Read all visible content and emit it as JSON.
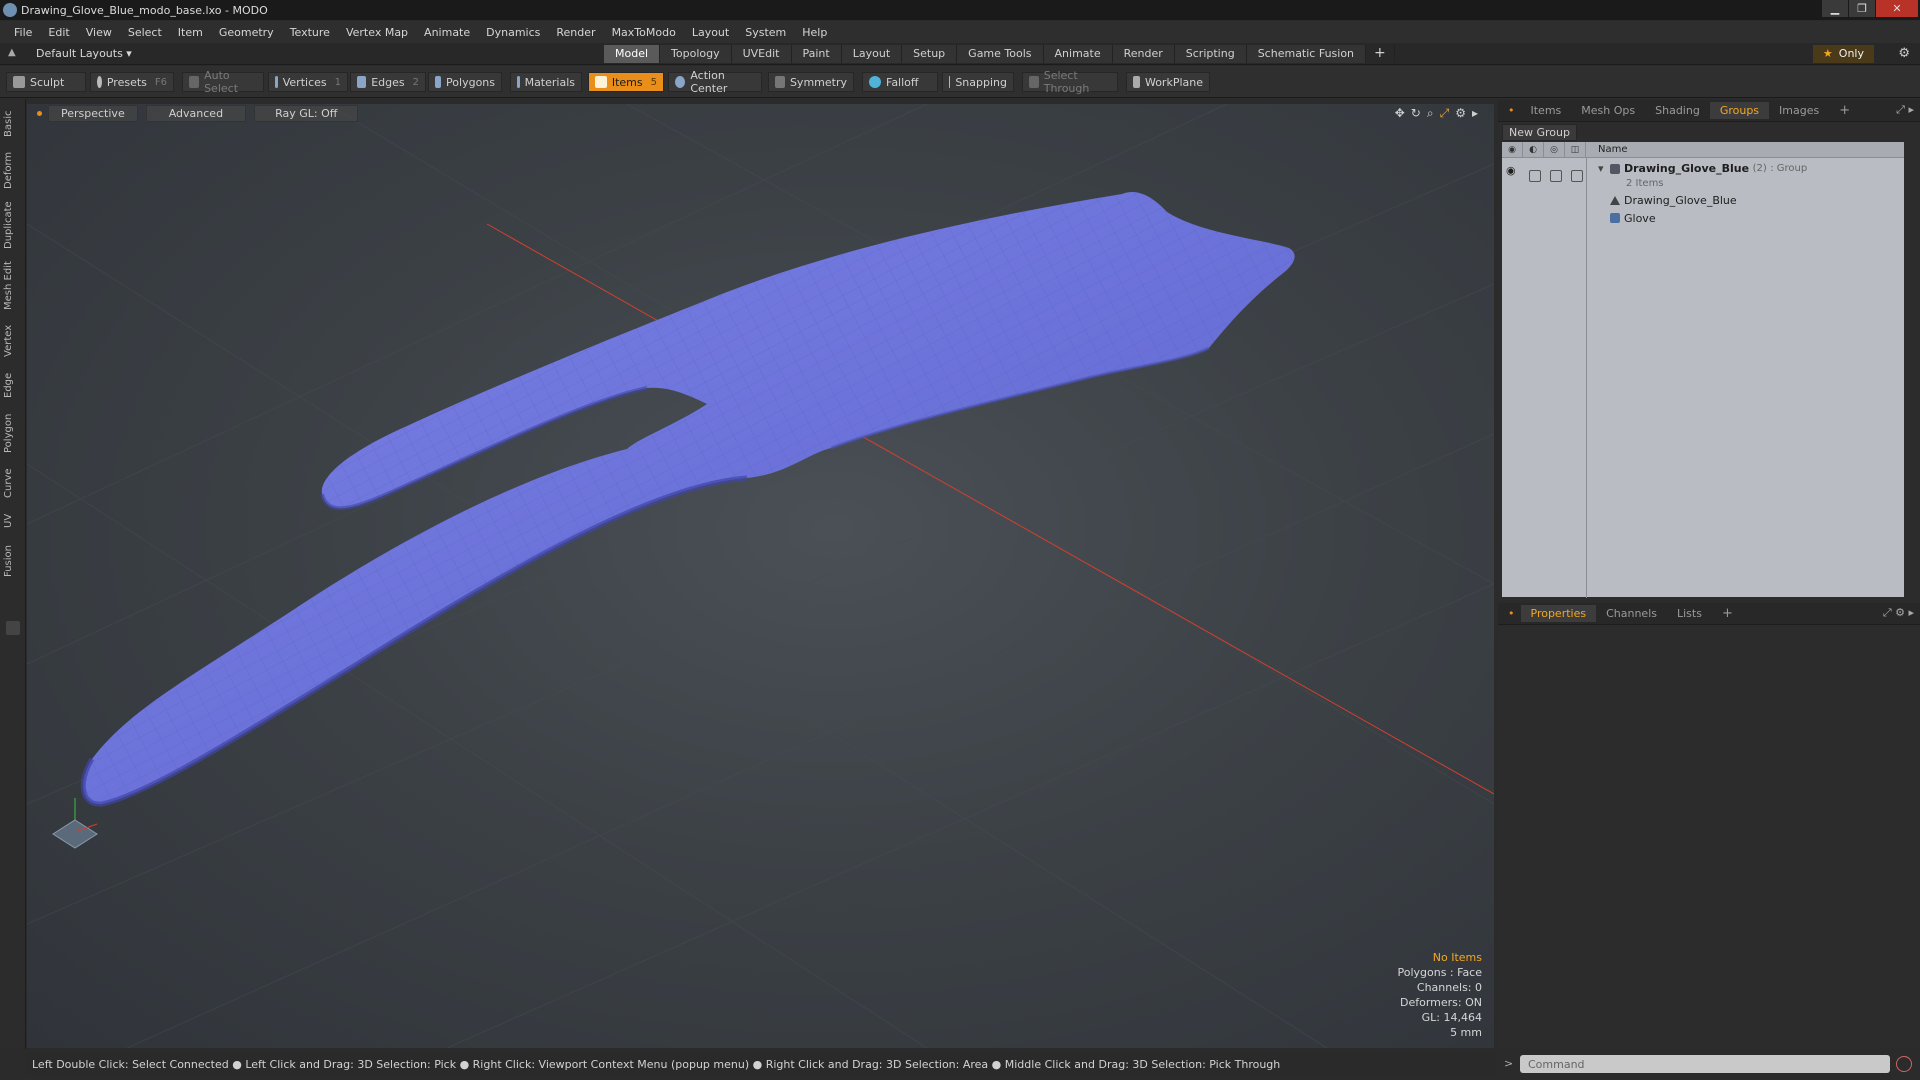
{
  "window": {
    "title": "Drawing_Glove_Blue_modo_base.lxo - MODO"
  },
  "menu": [
    "File",
    "Edit",
    "View",
    "Select",
    "Item",
    "Geometry",
    "Texture",
    "Vertex Map",
    "Animate",
    "Dynamics",
    "Render",
    "MaxToModo",
    "Layout",
    "System",
    "Help"
  ],
  "layout_bar": {
    "layouts_label": "Default Layouts ▾",
    "tabs": [
      "Model",
      "Topology",
      "UVEdit",
      "Paint",
      "Layout",
      "Setup",
      "Game Tools",
      "Animate",
      "Render",
      "Scripting",
      "Schematic Fusion"
    ],
    "active_tab": "Model",
    "add": "+",
    "only_label": "Only"
  },
  "toolbar": {
    "sculpt": "Sculpt",
    "presets": "Presets",
    "presets_key": "F6",
    "auto_select": "Auto Select",
    "vertices": "Vertices",
    "vertices_key": "1",
    "edges": "Edges",
    "edges_key": "2",
    "polygons": "Polygons",
    "materials": "Materials",
    "items": "Items",
    "items_key": "5",
    "action_center": "Action Center",
    "symmetry": "Symmetry",
    "falloff": "Falloff",
    "snapping": "Snapping",
    "select_through": "Select Through",
    "workplane": "WorkPlane"
  },
  "left_tabs": [
    "Basic",
    "Deform",
    "Duplicate",
    "Mesh Edit",
    "Vertex",
    "Edge",
    "Polygon",
    "Curve",
    "UV",
    "Fusion"
  ],
  "viewport": {
    "perspective": "Perspective",
    "advanced": "Advanced",
    "raygl": "Ray GL: Off",
    "info": {
      "no_items": "No Items",
      "polygons": "Polygons : Face",
      "channels": "Channels: 0",
      "deformers": "Deformers: ON",
      "gl": "GL: 14,464",
      "unit": "5 mm"
    }
  },
  "status_bar": "Left Double Click: Select Connected ● Left Click and Drag: 3D Selection: Pick ● Right Click: Viewport Context Menu (popup menu) ● Right Click and Drag: 3D Selection: Area ● Middle Click and Drag: 3D Selection: Pick Through",
  "top_panel": {
    "tabs": [
      "Items",
      "Mesh Ops",
      "Shading",
      "Groups",
      "Images"
    ],
    "active_tab": "Groups",
    "add": "+",
    "new_group": "New Group",
    "name_header": "Name",
    "group_name": "Drawing_Glove_Blue",
    "group_count": "(2)",
    "group_type": ": Group",
    "group_sub": "2 Items",
    "children": [
      "Drawing_Glove_Blue",
      "Glove"
    ]
  },
  "bottom_panel": {
    "tabs": [
      "Properties",
      "Channels",
      "Lists"
    ],
    "active_tab": "Properties",
    "add": "+"
  },
  "command": {
    "placeholder": "Command",
    "prompt": ">"
  },
  "colors": {
    "accent": "#e98e1b",
    "glove": "#6b72d6",
    "axis_x": "#d2402e",
    "axis_z": "#3a5fe0"
  }
}
